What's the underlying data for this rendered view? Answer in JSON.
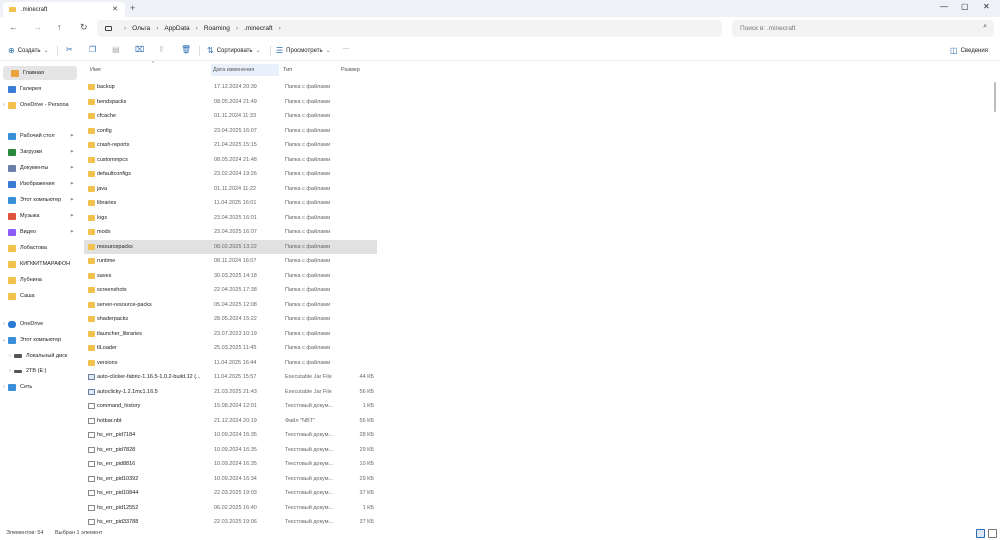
{
  "window": {
    "tab_title": ".minecraft",
    "tab_close": "✕",
    "new_tab": "+",
    "minimize": "—",
    "maximize": "▢",
    "close": "✕"
  },
  "nav": {
    "back": "←",
    "forward": "→",
    "up": "↑",
    "refresh": "↻",
    "breadcrumb": [
      "Ольга",
      "AppData",
      "Roaming",
      ".minecraft"
    ],
    "search_placeholder": "Поиск в: .minecraft"
  },
  "toolbar": {
    "new_label": "Создать",
    "sort_label": "Сортировать",
    "view_label": "Просмотреть",
    "more_label": "···",
    "details_label": "Сведения"
  },
  "sidebar": {
    "items": [
      {
        "label": "Главная",
        "icon": "home-icon",
        "color": "#e8a33d"
      },
      {
        "label": "Галерея",
        "icon": "gallery-icon",
        "color": "#3a7bd5"
      },
      {
        "label": "OneDrive - Persona",
        "icon": "folder-icon",
        "color": "#f2c14e"
      },
      {
        "label": "Рабочий стол",
        "icon": "desktop-icon",
        "color": "#3a8fd9"
      },
      {
        "label": "Загрузки",
        "icon": "download-icon",
        "color": "#2b8a3e"
      },
      {
        "label": "Документы",
        "icon": "documents-icon",
        "color": "#6b7fa8"
      },
      {
        "label": "Изображения",
        "icon": "pictures-icon",
        "color": "#3a7bd5"
      },
      {
        "label": "Этот компьютер",
        "icon": "computer-icon",
        "color": "#3a8fd9"
      },
      {
        "label": "Музыка",
        "icon": "music-icon",
        "color": "#e0533d"
      },
      {
        "label": "Видео",
        "icon": "video-icon",
        "color": "#8b5cf6"
      },
      {
        "label": "Лобастова",
        "icon": "folder-icon",
        "color": "#f2c14e"
      },
      {
        "label": "КИПФИТМАРАФОН",
        "icon": "folder-icon",
        "color": "#f2c14e"
      },
      {
        "label": "Лубнина",
        "icon": "folder-icon",
        "color": "#f2c14e"
      },
      {
        "label": "Саша",
        "icon": "folder-icon",
        "color": "#f2c14e"
      },
      {
        "label": "OneDrive",
        "icon": "cloud-icon",
        "color": "#2b7bd5"
      },
      {
        "label": "Этот компьютер",
        "icon": "computer-icon",
        "color": "#3a8fd9"
      },
      {
        "label": "Локальный диск",
        "icon": "drive-icon",
        "color": "#555555"
      },
      {
        "label": "2TB (E:)",
        "icon": "drive-icon",
        "color": "#555555"
      },
      {
        "label": "Сеть",
        "icon": "network-icon",
        "color": "#3a8fd9"
      }
    ]
  },
  "columns": {
    "name": "Имя",
    "date": "Дата изменения",
    "type": "Тип",
    "size": "Размер"
  },
  "files": [
    {
      "name": "backup",
      "date": "17.12.2024 20:39",
      "type": "Папка с файлами",
      "size": "",
      "kind": "folder"
    },
    {
      "name": "bendspacks",
      "date": "08.05.2024 21:49",
      "type": "Папка с файлами",
      "size": "",
      "kind": "folder"
    },
    {
      "name": "cfcache",
      "date": "01.11.2024 11:33",
      "type": "Папка с файлами",
      "size": "",
      "kind": "folder"
    },
    {
      "name": "config",
      "date": "23.04.2025 16:07",
      "type": "Папка с файлами",
      "size": "",
      "kind": "folder"
    },
    {
      "name": "crash-reports",
      "date": "21.04.2025 15:15",
      "type": "Папка с файлами",
      "size": "",
      "kind": "folder"
    },
    {
      "name": "custommpcs",
      "date": "08.05.2024 21:48",
      "type": "Папка с файлами",
      "size": "",
      "kind": "folder"
    },
    {
      "name": "defaultconfigs",
      "date": "23.02.2024 19:26",
      "type": "Папка с файлами",
      "size": "",
      "kind": "folder"
    },
    {
      "name": "java",
      "date": "01.11.2024 11:22",
      "type": "Папка с файлами",
      "size": "",
      "kind": "folder"
    },
    {
      "name": "libraries",
      "date": "11.04.2025 16:01",
      "type": "Папка с файлами",
      "size": "",
      "kind": "folder"
    },
    {
      "name": "logs",
      "date": "23.04.2025 16:01",
      "type": "Папка с файлами",
      "size": "",
      "kind": "folder"
    },
    {
      "name": "mods",
      "date": "23.04.2025 16:07",
      "type": "Папка с файлами",
      "size": "",
      "kind": "folder"
    },
    {
      "name": "resourcepacks",
      "date": "08.02.2025 13:22",
      "type": "Папка с файлами",
      "size": "",
      "kind": "folder",
      "selected": true
    },
    {
      "name": "runtime",
      "date": "08.11.2024 16:07",
      "type": "Папка с файлами",
      "size": "",
      "kind": "folder"
    },
    {
      "name": "saves",
      "date": "30.03.2025 14:18",
      "type": "Папка с файлами",
      "size": "",
      "kind": "folder"
    },
    {
      "name": "screenshots",
      "date": "22.04.2025 17:38",
      "type": "Папка с файлами",
      "size": "",
      "kind": "folder"
    },
    {
      "name": "server-resource-packs",
      "date": "05.04.2025 12:08",
      "type": "Папка с файлами",
      "size": "",
      "kind": "folder"
    },
    {
      "name": "shaderpacks",
      "date": "28.05.2024 15:22",
      "type": "Папка с файлами",
      "size": "",
      "kind": "folder"
    },
    {
      "name": "tlauncher_libraries",
      "date": "23.07.2023 10:19",
      "type": "Папка с файлами",
      "size": "",
      "kind": "folder"
    },
    {
      "name": "tlLoader",
      "date": "25.03.2025 11:45",
      "type": "Папка с файлами",
      "size": "",
      "kind": "folder"
    },
    {
      "name": "versions",
      "date": "11.04.2025 16:44",
      "type": "Папка с файлами",
      "size": "",
      "kind": "folder"
    },
    {
      "name": "auto-clicker-fabric-1.16.5-1.0.2-build.12 (...",
      "date": "11.04.2025 15:57",
      "type": "Executable Jar File",
      "size": "44 КБ",
      "kind": "exe"
    },
    {
      "name": "autoclicky-1.2.1mc1.16.5",
      "date": "21.03.2025 21:43",
      "type": "Executable Jar File",
      "size": "56 КБ",
      "kind": "exe"
    },
    {
      "name": "command_history",
      "date": "15.08.2024 12:01",
      "type": "Текстовый докум...",
      "size": "1 КБ",
      "kind": "file"
    },
    {
      "name": "hotbar.nbt",
      "date": "21.12.2024 20:19",
      "type": "Файл \"NBT\"",
      "size": "56 КБ",
      "kind": "file"
    },
    {
      "name": "hs_err_pid7184",
      "date": "10.09.2024 16:35",
      "type": "Текстовый докум...",
      "size": "28 КБ",
      "kind": "file"
    },
    {
      "name": "hs_err_pid7828",
      "date": "10.09.2024 16:35",
      "type": "Текстовый докум...",
      "size": "29 КБ",
      "kind": "file"
    },
    {
      "name": "hs_err_pid8816",
      "date": "10.09.2024 16:35",
      "type": "Текстовый докум...",
      "size": "10 КБ",
      "kind": "file"
    },
    {
      "name": "hs_err_pid10392",
      "date": "10.09.2024 16:34",
      "type": "Текстовый докум...",
      "size": "29 КБ",
      "kind": "file"
    },
    {
      "name": "hs_err_pid10844",
      "date": "22.03.2025 19:03",
      "type": "Текстовый докум...",
      "size": "37 КБ",
      "kind": "file"
    },
    {
      "name": "hs_err_pid12552",
      "date": "06.02.2025 16:40",
      "type": "Текстовый докум...",
      "size": "1 КБ",
      "kind": "file"
    },
    {
      "name": "hs_err_pid33788",
      "date": "22.03.2025 19:06",
      "type": "Текстовый докум...",
      "size": "37 КБ",
      "kind": "file"
    }
  ],
  "status": {
    "count": "Элементов: 54",
    "selected": "Выбран 1 элемент"
  }
}
